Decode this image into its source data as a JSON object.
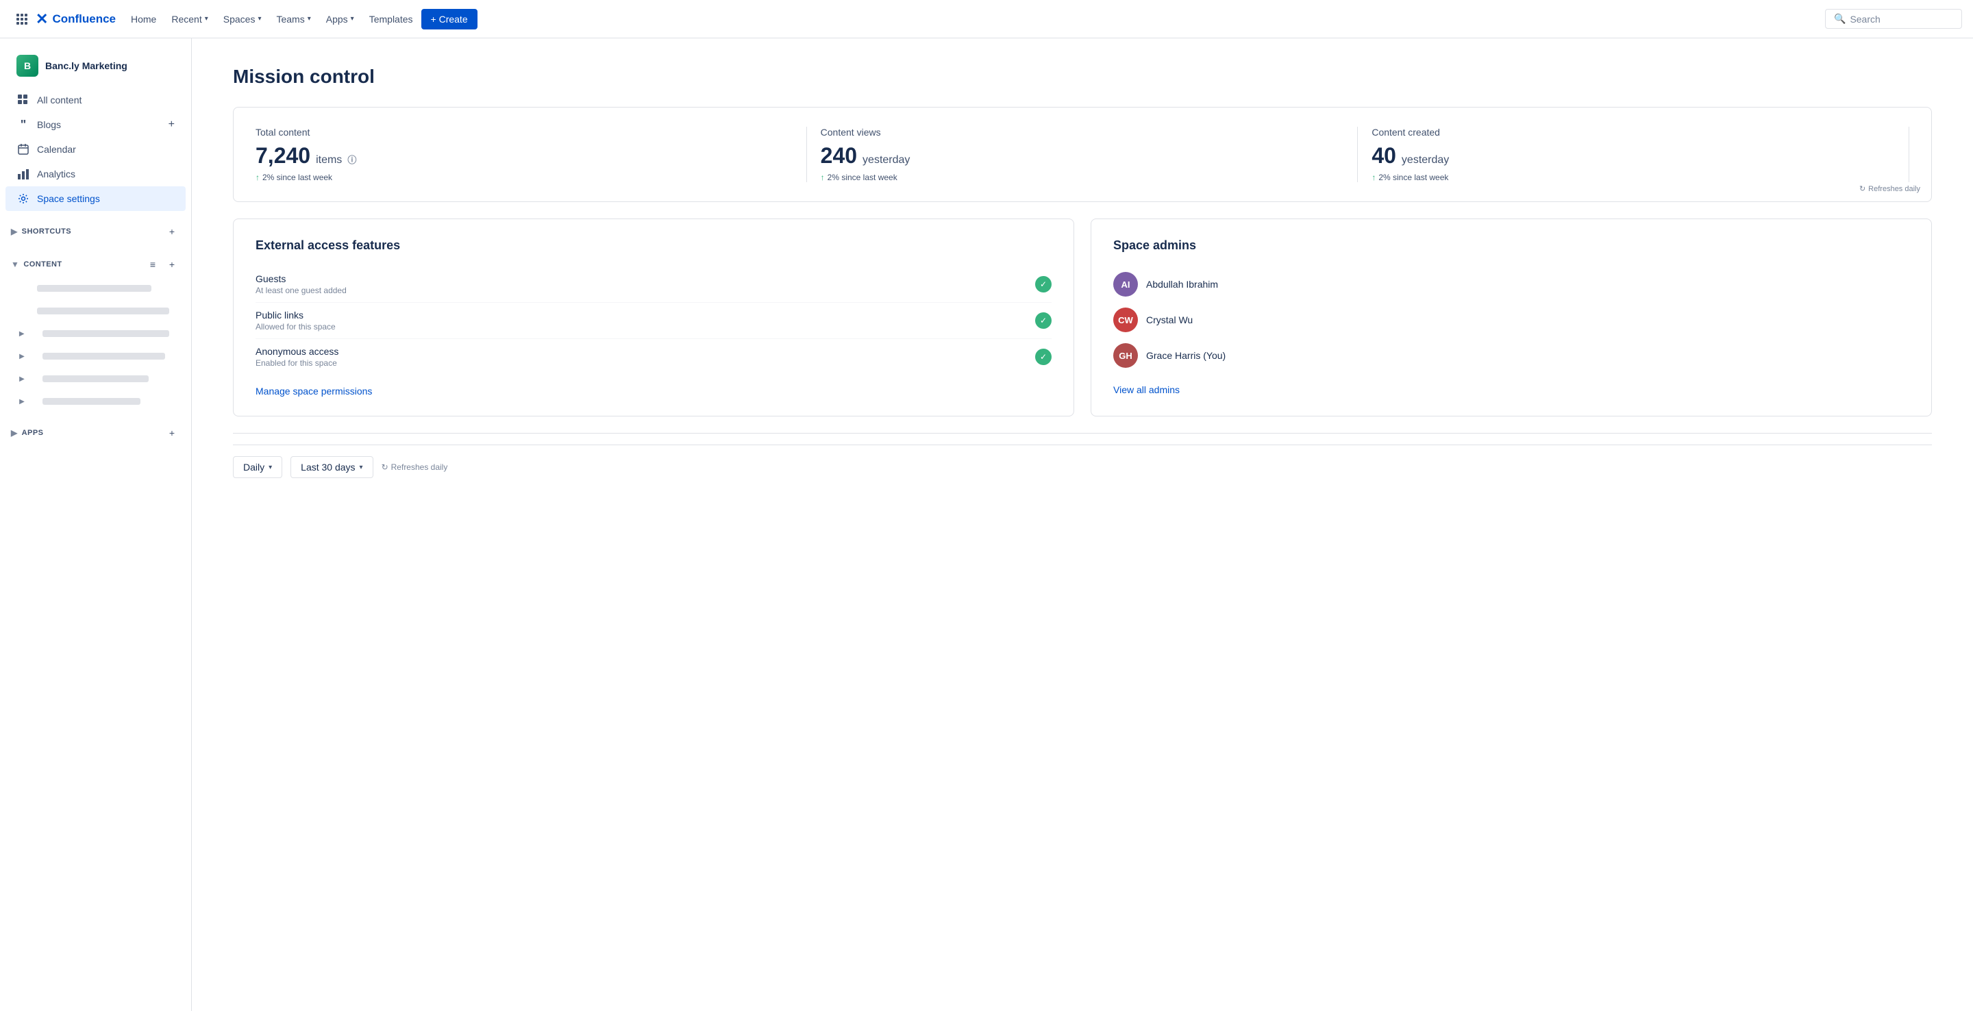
{
  "nav": {
    "logo_x": "✕",
    "logo_text": "Confluence",
    "items": [
      {
        "label": "Home",
        "has_dropdown": false
      },
      {
        "label": "Recent",
        "has_dropdown": true
      },
      {
        "label": "Spaces",
        "has_dropdown": true
      },
      {
        "label": "Teams",
        "has_dropdown": true
      },
      {
        "label": "Apps",
        "has_dropdown": true
      },
      {
        "label": "Templates",
        "has_dropdown": false
      }
    ],
    "create_label": "+ Create",
    "search_placeholder": "Search"
  },
  "sidebar": {
    "space_name": "Banc.ly Marketing",
    "nav_items": [
      {
        "label": "All content",
        "icon": "⊞",
        "active": false
      },
      {
        "label": "Blogs",
        "icon": "❝",
        "active": false
      },
      {
        "label": "Calendar",
        "icon": "📅",
        "active": false
      },
      {
        "label": "Analytics",
        "icon": "📊",
        "active": false
      },
      {
        "label": "Space settings",
        "icon": "⚙",
        "active": true
      }
    ],
    "shortcuts_label": "SHORTCUTS",
    "content_label": "CONTENT",
    "apps_label": "APPS",
    "content_placeholders": [
      {
        "width": "70"
      },
      {
        "width": "85"
      },
      {
        "width": "80"
      },
      {
        "width": "75"
      },
      {
        "width": "65"
      },
      {
        "width": "60"
      }
    ]
  },
  "main": {
    "page_title": "Mission control",
    "stats": {
      "total_content": {
        "label": "Total content",
        "value": "7,240",
        "unit": "items",
        "change": "2% since last week"
      },
      "content_views": {
        "label": "Content views",
        "value": "240",
        "unit": "yesterday",
        "change": "2% since last week"
      },
      "content_created": {
        "label": "Content created",
        "value": "40",
        "unit": "yesterday",
        "change": "2% since last week"
      },
      "refreshes_label": "Refreshes daily"
    },
    "external_access": {
      "title": "External access features",
      "items": [
        {
          "name": "Guests",
          "desc": "At least one guest added",
          "enabled": true
        },
        {
          "name": "Public links",
          "desc": "Allowed for this space",
          "enabled": true
        },
        {
          "name": "Anonymous access",
          "desc": "Enabled for this space",
          "enabled": true
        }
      ],
      "manage_link": "Manage space permissions"
    },
    "space_admins": {
      "title": "Space admins",
      "admins": [
        {
          "name": "Abdullah Ibrahim",
          "color": "#7b5ea7"
        },
        {
          "name": "Crystal Wu",
          "color": "#c94040"
        },
        {
          "name": "Grace Harris (You)",
          "color": "#c94040"
        }
      ],
      "view_link": "View all admins"
    },
    "filters": {
      "period_label": "Daily",
      "range_label": "Last 30 days",
      "refresh_note": "Refreshes daily"
    }
  }
}
